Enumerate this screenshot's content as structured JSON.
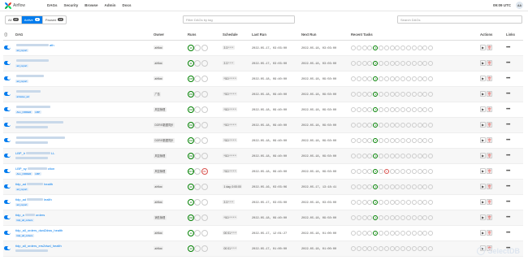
{
  "nav": {
    "brand": "Airflow",
    "items": [
      "DAGs",
      "Security",
      "Browse",
      "Admin",
      "Docs"
    ],
    "time": "09:09 UTC",
    "avatar": "AA"
  },
  "filters": {
    "all_label": "All",
    "all_count": "27",
    "active_label": "Active",
    "active_count": "11",
    "paused_label": "Paused",
    "paused_count": "16",
    "tag_placeholder": "Filter DAGs by tag",
    "search_placeholder": "Search DAGs"
  },
  "columns": [
    "DAG",
    "Owner",
    "Runs",
    "Schedule",
    "Last Run",
    "Next Run",
    "Recent Tasks",
    "Actions",
    "Links"
  ],
  "rows": [
    {
      "name": "",
      "name_blur": 40,
      "name_suffix": "ath",
      "tags": [
        "ad_report"
      ],
      "owner": "airflow",
      "run1": "10",
      "run1_red": "",
      "schedule": "3 3 * * *",
      "last": "2022-05-17, 03:03:00",
      "next": "2022-05-18, 03:03:00",
      "task_success": "3",
      "task_fail": ""
    },
    {
      "name": "",
      "name_blur": 40,
      "name_suffix": "",
      "tags": [
        "ad_report"
      ],
      "owner": "airflow",
      "run1": "11",
      "run1_red": "",
      "schedule": "3 3 * * *",
      "last": "2022-05-17, 03:03:00",
      "next": "2022-05-18, 03:03:00",
      "task_success": "1",
      "task_fail": ""
    },
    {
      "name": "",
      "name_blur": 34,
      "name_suffix": "",
      "tags": [
        "ad_report"
      ],
      "owner": "airflow",
      "run1": "265",
      "run1_red": "",
      "schedule": "*/10 * * * *",
      "last": "2022-05-18, 09:40:00",
      "next": "2022-05-18, 09:50:00",
      "task_success": "1",
      "task_fail": ""
    },
    {
      "name": "",
      "name_blur": 30,
      "name_suffix": "",
      "tags": [
        "airwave_ad"
      ],
      "owner": "广告",
      "run1": "260",
      "run1_red": "",
      "schedule": "*/10 * * * *",
      "last": "2022-05-18, 09:40:00",
      "next": "2022-05-18, 09:50:00",
      "task_success": "1",
      "task_fail": ""
    },
    {
      "name": "",
      "name_blur": 42,
      "name_suffix": "",
      "tags": [
        "ALL_ORDER",
        "LBP"
      ],
      "owner": "风控管理",
      "run1": "262",
      "run1_red": "",
      "schedule": "*/10 * * * *",
      "last": "2022-05-18, 09:40:00",
      "next": "2022-05-18, 09:50:00",
      "task_success": "1",
      "task_fail": ""
    },
    {
      "name": "",
      "name_blur": 58,
      "name_suffix": "",
      "tags": [
        ""
      ],
      "owner": "DORIS数据同步",
      "run1": "262",
      "run1_red": "",
      "schedule": "*/10 * * * *",
      "last": "2022-05-18, 09:40:00",
      "next": "2022-05-18, 09:50:00",
      "task_success": "1",
      "task_fail": ""
    },
    {
      "name": "",
      "name_blur": 60,
      "name_suffix": "",
      "tags": [
        ""
      ],
      "owner": "DORIS数据同步",
      "run1": "262",
      "run1_red": "",
      "schedule": "*/10 * * * *",
      "last": "2022-05-18, 09:40:00",
      "next": "2022-05-18, 09:50:00",
      "task_success": "1",
      "task_fail": ""
    },
    {
      "name": "LBP_lr",
      "name_blur": 30,
      "name_suffix": "LL",
      "tags": [
        ""
      ],
      "owner": "风控管理",
      "run1": "262",
      "run1_red": "",
      "schedule": "*/10 * * * *",
      "last": "2022-05-18, 09:40:00",
      "next": "2022-05-18, 09:50:00",
      "task_success": "1",
      "task_fail": ""
    },
    {
      "name": "LBP_sy",
      "name_blur": 24,
      "name_suffix": "ction",
      "tags": [
        "ALL_ORDER",
        "LBP"
      ],
      "owner": "风控管理",
      "run1": "2272",
      "run1_red": "280",
      "schedule": "*/10 * * * *",
      "last": "2022-05-18, 09:40:00",
      "next": "2022-05-18, 09:50:00",
      "task_success": "3",
      "task_fail": "1"
    },
    {
      "name": "tidp_ad",
      "name_blur": 20,
      "name_suffix": "health",
      "tags": [
        "ad_report"
      ],
      "owner": "airflow",
      "run1": "20",
      "run1_red": "",
      "schedule": "1 day, 0:00:00",
      "last": "2022-05-16, 03:03:06",
      "next": "2022-05-17, 13:18:41",
      "task_success": "1",
      "task_fail": ""
    },
    {
      "name": "tidp_ad",
      "name_blur": 20,
      "name_suffix": "lealth",
      "tags": [
        "ad_report"
      ],
      "owner": "airflow",
      "run1": "10",
      "run1_red": "",
      "schedule": "3 3 * * *",
      "last": "2022-05-17, 03:03:00",
      "next": "2022-05-18, 03:03:00",
      "task_success": "4",
      "task_fail": ""
    },
    {
      "name": "tidp_a",
      "name_blur": 12,
      "name_suffix": "orders",
      "tags": [
        "tidp_all_orders"
      ],
      "owner": "销售管理",
      "run1": "262",
      "run1_red": "",
      "schedule": "*/10 * * * *",
      "last": "2022-05-18, 09:40:00",
      "next": "2022-05-18, 09:50:00",
      "task_success": "1",
      "task_fail": ""
    },
    {
      "name": "tidp_all_orders_dwd2dws_health",
      "name_blur": 0,
      "name_suffix": "",
      "tags": [
        "tidp_all_orders"
      ],
      "owner": "airflow",
      "run1": "14",
      "run1_red": "",
      "schedule": "00 01 * * *",
      "last": "2022-05-17, 12:01:27",
      "next": "2022-05-18, 01:00:00",
      "task_success": "1",
      "task_fail": ""
    },
    {
      "name": "tidp_all_orders_ers2dwd_health",
      "name_blur": 0,
      "name_suffix": "",
      "tags": [
        ""
      ],
      "owner": "airflow",
      "run1": "14",
      "run1_red": "",
      "schedule": "00 01 * * *",
      "last": "2022-05-17, 01:00:00",
      "next": "2022-05-18, 01:00:00",
      "task_success": "",
      "task_fail": ""
    }
  ],
  "watermark": "SelectDB",
  "colors": {
    "accent": "#017cee",
    "success": "#008000",
    "failed": "#d9534f"
  }
}
